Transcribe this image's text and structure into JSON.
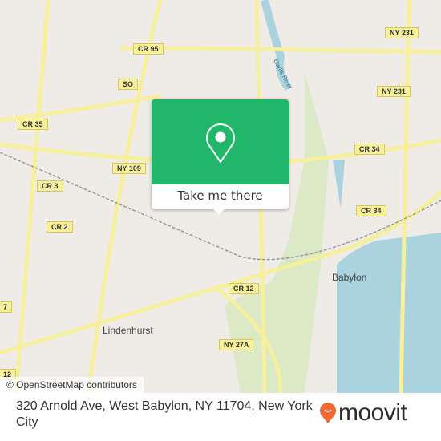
{
  "map": {
    "colors": {
      "land": "#efebe6",
      "water": "#aad3df",
      "road": "#f6ef9c",
      "park": "#cde8b0",
      "accent": "#21b76a"
    },
    "road_labels": [
      "CR 95",
      "NY 231",
      "NY 231",
      "SO",
      "CR 35",
      "NY 109",
      "CR 34",
      "CR 34",
      "CR 3",
      "CR 2",
      "CR 12",
      "NY 27A",
      "7",
      "12"
    ],
    "places": [
      "Babylon",
      "Lindenhurst"
    ],
    "river": "Carlls River",
    "attribution": "© OpenStreetMap contributors"
  },
  "popup": {
    "icon": "location-pin-icon",
    "button_label": "Take me there"
  },
  "footer": {
    "address": "320 Arnold Ave, West Babylon, NY 11704, New York City",
    "brand": "moovit",
    "brand_color": "#f26a32"
  }
}
